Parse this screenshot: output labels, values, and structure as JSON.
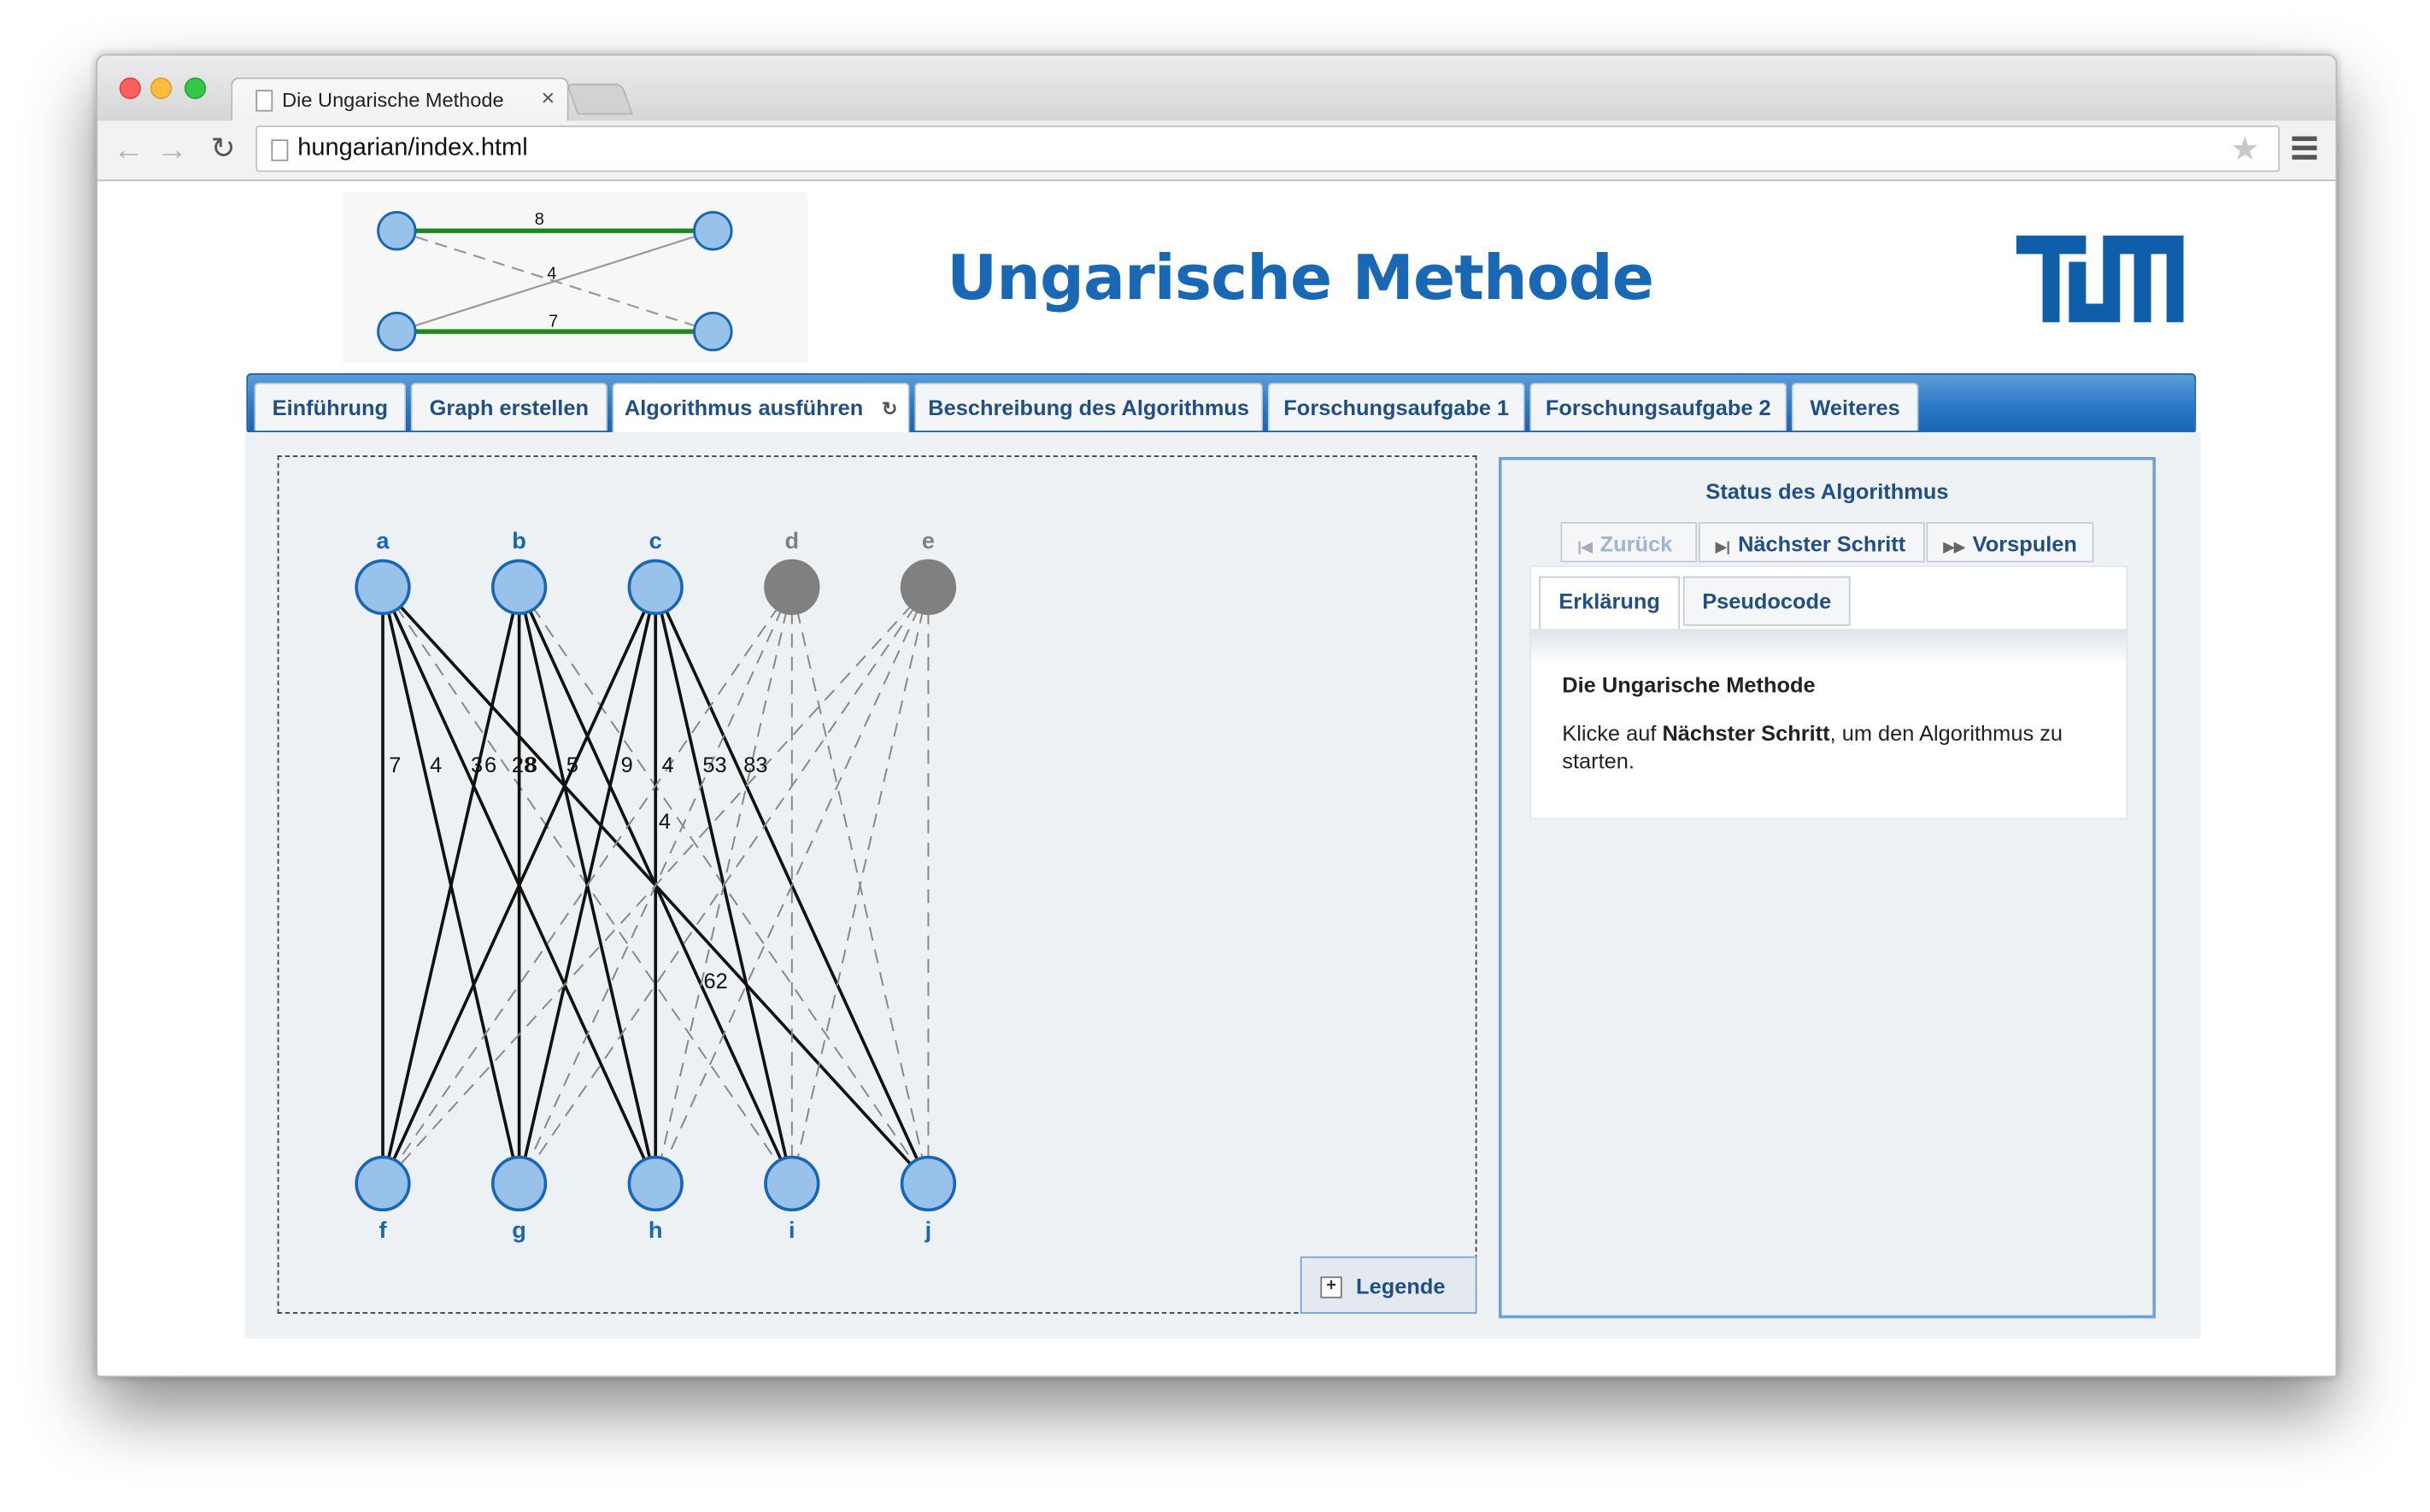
{
  "browser": {
    "tab_title": "Die Ungarische Methode",
    "url": "hungarian/index.html"
  },
  "header": {
    "title": "Ungarische Methode",
    "banner_edge_labels": [
      "8",
      "4",
      "7"
    ]
  },
  "nav_tabs": [
    {
      "label": "Einführung"
    },
    {
      "label": "Graph erstellen"
    },
    {
      "label": "Algorithmus ausführen"
    },
    {
      "label": "Beschreibung des Algorithmus"
    },
    {
      "label": "Forschungsaufgabe 1"
    },
    {
      "label": "Forschungsaufgabe 2"
    },
    {
      "label": "Weiteres"
    }
  ],
  "graph": {
    "top_nodes": [
      {
        "label": "a",
        "active": true
      },
      {
        "label": "b",
        "active": true
      },
      {
        "label": "c",
        "active": true
      },
      {
        "label": "d",
        "active": false
      },
      {
        "label": "e",
        "active": false
      }
    ],
    "bottom_nodes": [
      "f",
      "g",
      "h",
      "i",
      "j"
    ],
    "edges": [
      {
        "from": "a",
        "to": "f",
        "weight": "7",
        "solid": true
      },
      {
        "from": "a",
        "to": "g",
        "weight": "4",
        "solid": true
      },
      {
        "from": "a",
        "to": "h",
        "weight": "3",
        "solid": true
      },
      {
        "from": "a",
        "to": "i",
        "weight": "28",
        "solid": false
      },
      {
        "from": "a",
        "to": "j",
        "weight": "",
        "solid": true
      },
      {
        "from": "b",
        "to": "f",
        "weight": "6",
        "solid": true
      },
      {
        "from": "b",
        "to": "g",
        "weight": "8",
        "solid": true
      },
      {
        "from": "b",
        "to": "h",
        "weight": "5",
        "solid": true
      },
      {
        "from": "b",
        "to": "i",
        "weight": "",
        "solid": true
      },
      {
        "from": "b",
        "to": "j",
        "weight": "",
        "solid": false
      },
      {
        "from": "c",
        "to": "f",
        "weight": "",
        "solid": true
      },
      {
        "from": "c",
        "to": "g",
        "weight": "9",
        "solid": true
      },
      {
        "from": "c",
        "to": "h",
        "weight": "4",
        "solid": true
      },
      {
        "from": "c",
        "to": "i",
        "weight": "53",
        "solid": true
      },
      {
        "from": "c",
        "to": "j",
        "weight": "83",
        "solid": true
      },
      {
        "from": "d",
        "to": "f",
        "weight": "",
        "solid": false
      },
      {
        "from": "d",
        "to": "g",
        "weight": "",
        "solid": false
      },
      {
        "from": "d",
        "to": "h",
        "weight": "",
        "solid": false
      },
      {
        "from": "d",
        "to": "i",
        "weight": "",
        "solid": false
      },
      {
        "from": "d",
        "to": "j",
        "weight": "",
        "solid": false
      },
      {
        "from": "e",
        "to": "f",
        "weight": "",
        "solid": false
      },
      {
        "from": "e",
        "to": "g",
        "weight": "",
        "solid": false
      },
      {
        "from": "e",
        "to": "h",
        "weight": "",
        "solid": false
      },
      {
        "from": "e",
        "to": "i",
        "weight": "",
        "solid": false
      },
      {
        "from": "e",
        "to": "j",
        "weight": "",
        "solid": false
      }
    ],
    "extra_weight_labels": [
      "4",
      "62"
    ]
  },
  "legend": {
    "label": "Legende"
  },
  "status": {
    "title": "Status des Algorithmus",
    "back_label": "Zurück",
    "next_label": "Nächster Schritt",
    "forward_label": "Vorspulen",
    "tab_explanation": "Erklärung",
    "tab_pseudocode": "Pseudocode",
    "heading": "Die Ungarische Methode",
    "text_before": "Klicke auf ",
    "text_bold": "Nächster Schritt",
    "text_after": ", um den Algorithmus zu starten."
  },
  "colors": {
    "accent": "#1868b5",
    "node_fill": "#99c2ea",
    "node_stroke": "#1767b4",
    "inactive_node": "#808080",
    "matching_edge": "#1a8a1a"
  }
}
